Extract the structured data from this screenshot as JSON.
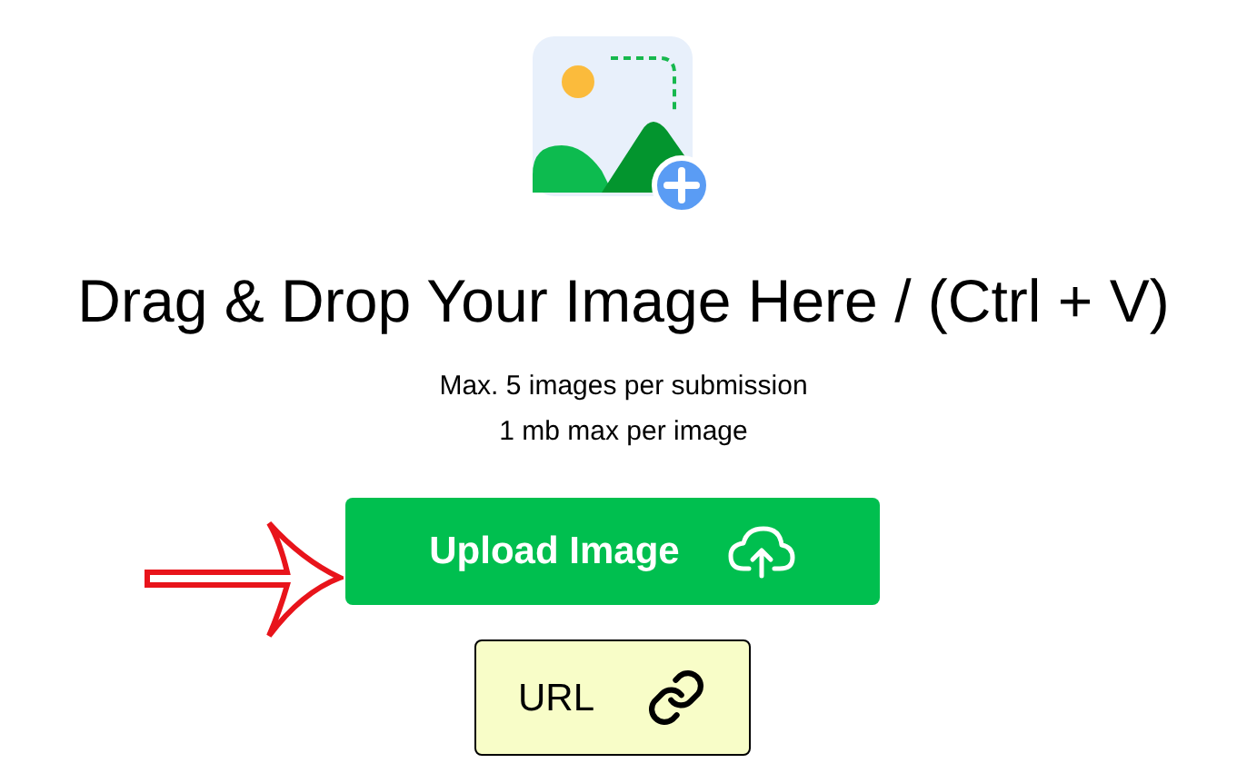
{
  "heading": "Drag & Drop Your Image Here / (Ctrl + V)",
  "limits": [
    "Max. 5 images per submission",
    "1 mb max per image"
  ],
  "buttons": [
    {
      "kind": "upload",
      "label": "Upload Image"
    },
    {
      "kind": "url",
      "label": "URL"
    }
  ]
}
